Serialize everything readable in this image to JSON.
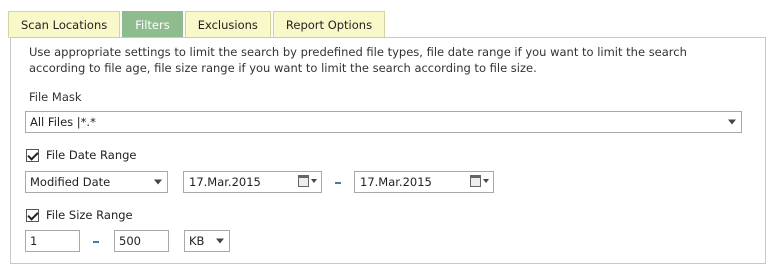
{
  "tabs": [
    {
      "label": "Scan Locations",
      "active": false
    },
    {
      "label": "Filters",
      "active": true
    },
    {
      "label": "Exclusions",
      "active": false
    },
    {
      "label": "Report Options",
      "active": false
    }
  ],
  "description": "Use appropriate settings to limit the search by predefined file types, file date range if you want to limit the search according to file age, file size range if you want to limit the search according to file size.",
  "file_mask": {
    "label": "File Mask",
    "value": "All Files |*.*"
  },
  "date_range": {
    "label": "File Date Range",
    "checked": true,
    "mode": "Modified Date",
    "from": "17.Mar.2015",
    "to": "17.Mar.2015"
  },
  "size_range": {
    "label": "File Size Range",
    "checked": true,
    "min": "1",
    "max": "500",
    "unit": "KB"
  },
  "colors": {
    "tab_bg": "#f8f8c8",
    "tab_active_bg": "#8fbc8f",
    "dash": "#3c7fb1"
  }
}
